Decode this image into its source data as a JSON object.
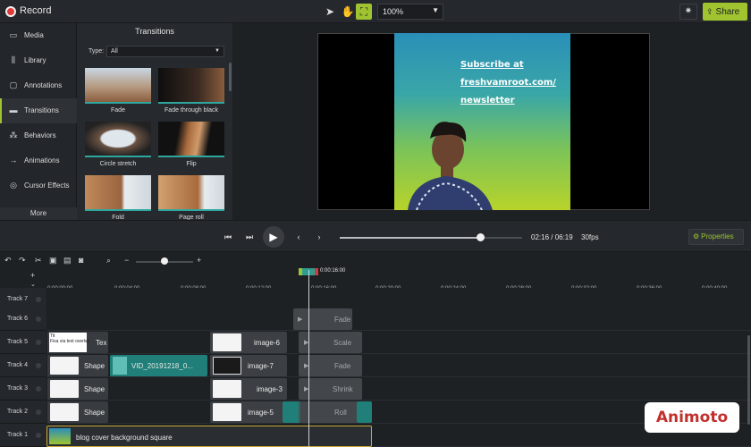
{
  "topbar": {
    "record_label": "Record",
    "zoom_value": "100%",
    "share_label": "Share",
    "tools": [
      "cursor-icon",
      "hand-icon",
      "crop-icon"
    ]
  },
  "sidebar": {
    "items": [
      {
        "label": "Media",
        "icon": "media-icon"
      },
      {
        "label": "Library",
        "icon": "library-icon"
      },
      {
        "label": "Annotations",
        "icon": "annotations-icon"
      },
      {
        "label": "Transitions",
        "icon": "transitions-icon"
      },
      {
        "label": "Behaviors",
        "icon": "behaviors-icon"
      },
      {
        "label": "Animations",
        "icon": "animations-icon"
      },
      {
        "label": "Cursor Effects",
        "icon": "cursor-effects-icon"
      }
    ],
    "more_label": "More"
  },
  "panel": {
    "title": "Transitions",
    "type_label": "Type:",
    "type_value": "All",
    "thumbnails": [
      {
        "label": "Fade"
      },
      {
        "label": "Fade through black"
      },
      {
        "label": "Circle stretch"
      },
      {
        "label": "Flip"
      },
      {
        "label": "Fold"
      },
      {
        "label": "Page roll"
      }
    ]
  },
  "preview": {
    "line1": "Subscribe at",
    "line2": "freshvamroot.com/",
    "line3": "newsletter"
  },
  "playback": {
    "timecode": "02:16 / 06:19",
    "fps": "30fps",
    "properties_label": "Properties",
    "progress": 0.77
  },
  "timeline": {
    "playhead_label": "0:00:16:00",
    "zoom_level": 0.5,
    "ticks": [
      "0:00:00:00",
      "0:00:04:00",
      "0:00:08:00",
      "0:00:12:00",
      "0:00:16:00",
      "0:00:20:00",
      "0:00:24:00",
      "0:00:28:00",
      "0:00:32:00",
      "0:00:36:00",
      "0:00:40:00"
    ],
    "tracks": [
      "Track 7",
      "Track 6",
      "Track 5",
      "Track 4",
      "Track 3",
      "Track 2",
      "Track 1"
    ],
    "clips": {
      "t6_fade": "Fade",
      "t5_text_title": "Tit",
      "t5_text_desc": "Fixa via text overlay",
      "t5_tex": "Tex",
      "t5_image": "image-6",
      "t5_trans": "Scale",
      "t4_shape": "Shape",
      "t4_video": "VID_20191218_0...",
      "t4_image": "image-7",
      "t4_trans": "Fade",
      "t3_shape": "Shape",
      "t3_image": "image-3",
      "t3_trans": "Shrink",
      "t2_shape": "Shape",
      "t2_image": "image-5",
      "t2_trans": "Roll",
      "t1_bg": "blog cover background square"
    }
  },
  "watermark": "Animoto"
}
